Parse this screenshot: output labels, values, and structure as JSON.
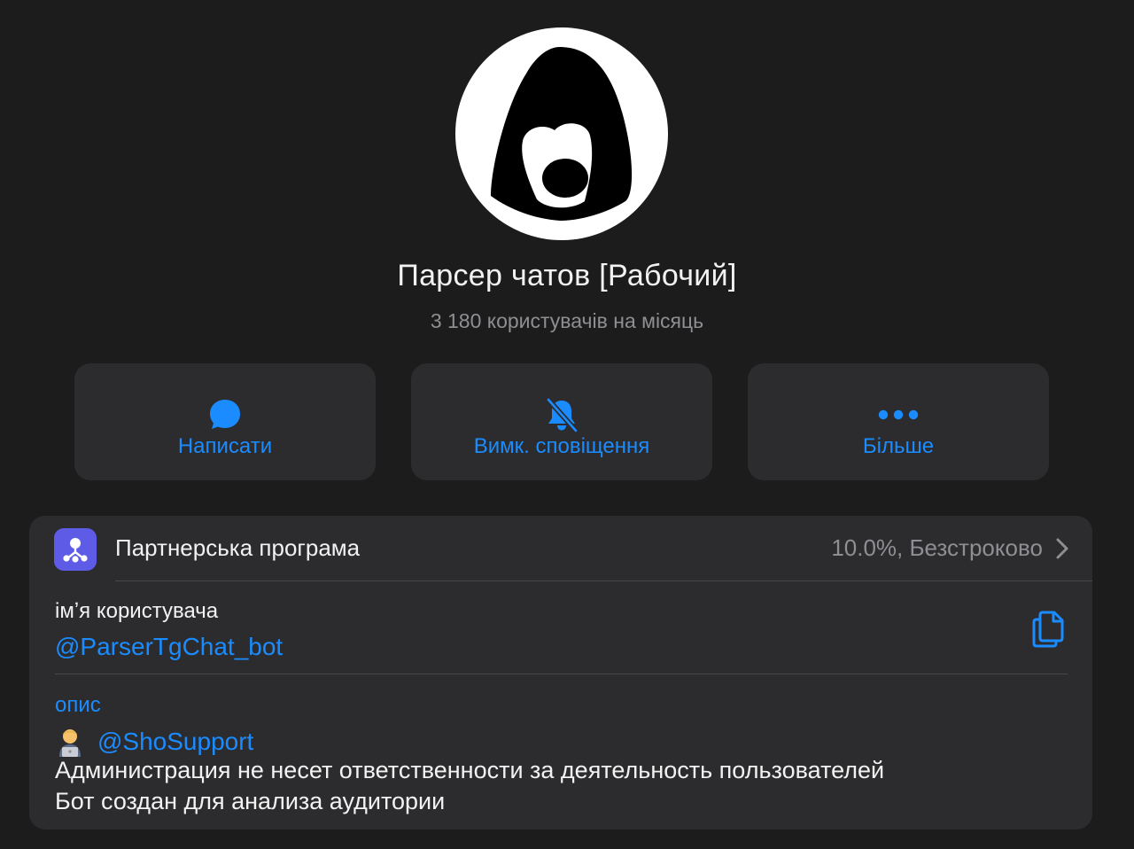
{
  "profile": {
    "title": "Парсер чатов [Рабочий]",
    "subtitle": "3 180 користувачів на місяць",
    "avatar_icon": "hooded-figure-logo"
  },
  "actions": [
    {
      "label": "Написати",
      "icon": "chat-bubble-icon"
    },
    {
      "label": "Вимк. сповіщення",
      "icon": "bell-slash-icon"
    },
    {
      "label": "Більше",
      "icon": "ellipsis-icon"
    }
  ],
  "partner": {
    "label": "Партнерська програма",
    "value": "10.0%, Безстроково",
    "icon": "affiliate-network-icon"
  },
  "info": {
    "username_label": "імʼя користувача",
    "username": "@ParserTgChat_bot",
    "description_label": "опис",
    "support_handle": "@ShoSupport",
    "description_lines": [
      "Администрация не несет ответственности за деятельность пользователей",
      "Бот создан для анализа аудитории"
    ]
  },
  "colors": {
    "background": "#1c1c1d",
    "card": "#2c2c2e",
    "accent": "#1a8cff",
    "secondary_text": "#8e8e93",
    "partner_icon_bg": "#5e5ce6"
  }
}
